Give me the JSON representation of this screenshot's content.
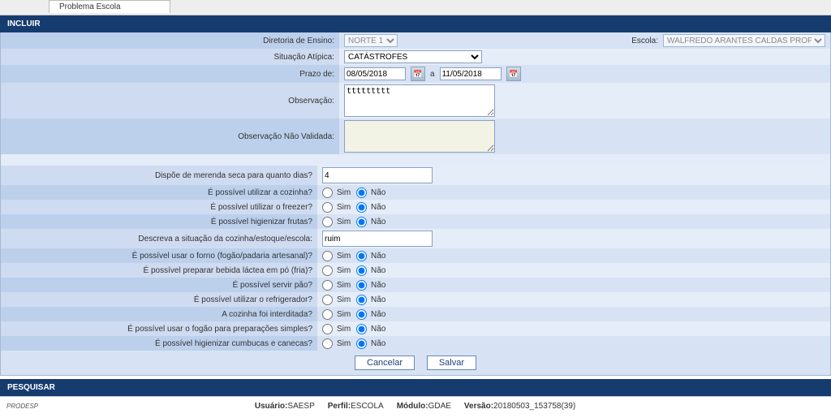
{
  "tab": {
    "title": "Problema Escola"
  },
  "sections": {
    "incluir": "INCLUIR",
    "pesquisar": "PESQUISAR"
  },
  "fields": {
    "diretoria_label": "Diretoria de Ensino:",
    "diretoria_value": "NORTE 1",
    "escola_label": "Escola:",
    "escola_value": "WALFREDO ARANTES CALDAS PROFESSOR",
    "situacao_label": "Situação Atípica:",
    "situacao_value": "CATÁSTROFES",
    "prazo_label": "Prazo de:",
    "prazo_de": "08/05/2018",
    "prazo_sep": "a",
    "prazo_ate": "11/05/2018",
    "obs_label": "Observação:",
    "obs_value": "ttttttttt",
    "obs_nv_label": "Observação Não Validada:",
    "obs_nv_value": ""
  },
  "questions": {
    "merenda_label": "Dispõe de merenda seca para quanto dias?",
    "merenda_value": "4",
    "q1": "É possível utilizar a cozinha?",
    "q2": "É possível utilizar o freezer?",
    "q3": "É possível higienizar frutas?",
    "desc_label": "Descreva a situação da cozinha/estoque/escola:",
    "desc_value": "ruim",
    "q4": "É possível usar o forno (fogão/padaria artesanal)?",
    "q5": "É possível preparar bebida láctea em pó (fria)?",
    "q6": "É possível servir pão?",
    "q7": "É possível utilizar o refrigerador?",
    "q8": "A cozinha foi interditada?",
    "q9": "É possível usar o fogão para preparações simples?",
    "q10": "É possível higienizar cumbucas e canecas?"
  },
  "radio": {
    "sim": "Sim",
    "nao": "Não"
  },
  "buttons": {
    "cancelar": "Cancelar",
    "salvar": "Salvar"
  },
  "footer": {
    "usuario_label": "Usuário:",
    "usuario": "SAESP",
    "perfil_label": "Perfil:",
    "perfil": "ESCOLA",
    "modulo_label": "Módulo:",
    "modulo": "GDAE",
    "versao_label": "Versão:",
    "versao": "20180503_153758(39)"
  }
}
